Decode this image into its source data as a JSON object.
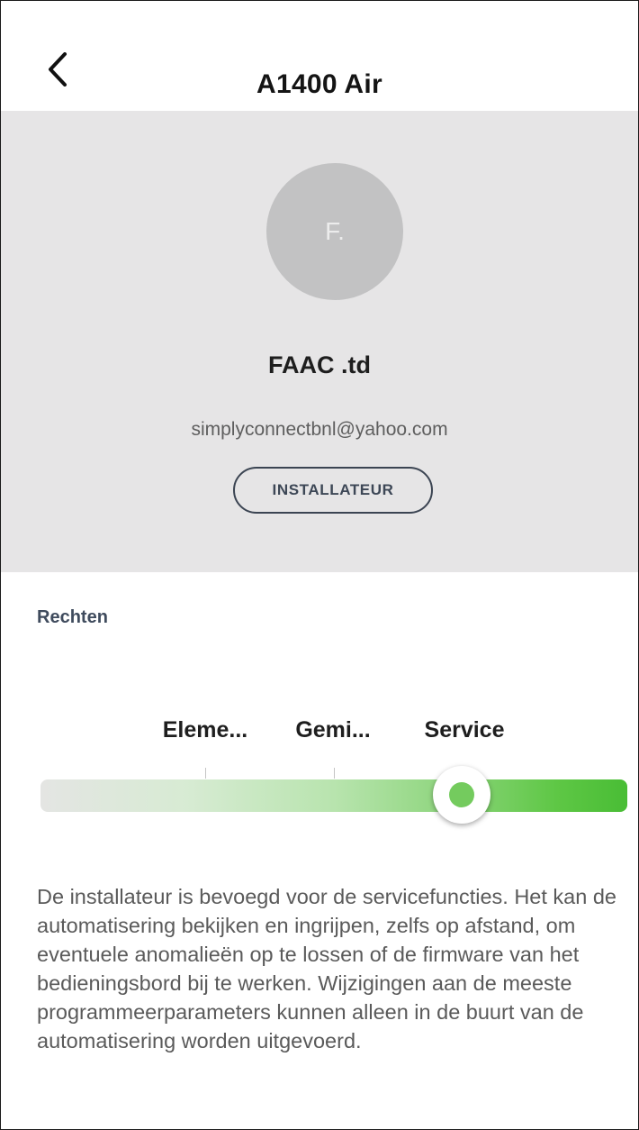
{
  "header": {
    "title": "A1400 Air",
    "back_icon": "chevron-left-icon"
  },
  "profile": {
    "avatar_initial": "F.",
    "name": "FAAC .td",
    "email": "simplyconnectbnl@yahoo.com",
    "role": "INSTALLATEUR"
  },
  "rights": {
    "section_label": "Rechten",
    "levels": [
      "Eleme...",
      "Gemi...",
      "Service"
    ],
    "selected_level": "Service",
    "slider_value_fraction": 0.72,
    "description": "De installateur is bevoegd voor de servicefuncties. Het kan de automatisering bekijken en ingrijpen, zelfs op afstand, om eventuele anomalieën op te lossen of de firmware van het bedieningsbord bij te werken. Wijzigingen aan de meeste programmeerparameters kunnen alleen in de buurt van de automatisering worden uitgevoerd."
  },
  "colors": {
    "panel_background": "#e6e5e6",
    "avatar_background": "#c2c2c3",
    "accent_green": "#49bd35",
    "thumb_dot": "#74cb5e",
    "section_label": "#3f4b5d"
  }
}
